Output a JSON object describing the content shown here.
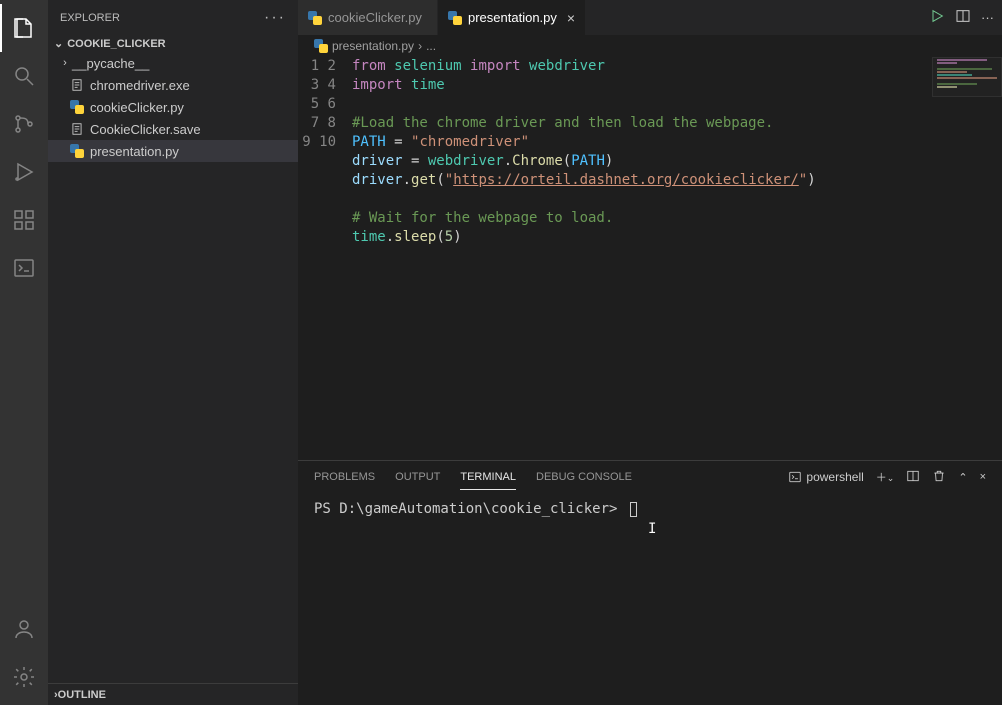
{
  "sidebar": {
    "title": "EXPLORER",
    "folder_name": "COOKIE_CLICKER",
    "items": [
      {
        "label": "__pycache__",
        "type": "folder"
      },
      {
        "label": "chromedriver.exe",
        "type": "file"
      },
      {
        "label": "cookieClicker.py",
        "type": "python"
      },
      {
        "label": "CookieClicker.save",
        "type": "file"
      },
      {
        "label": "presentation.py",
        "type": "python"
      }
    ],
    "outline_label": "OUTLINE"
  },
  "tabs": [
    {
      "label": "cookieClicker.py",
      "active": false
    },
    {
      "label": "presentation.py",
      "active": true
    }
  ],
  "breadcrumb": {
    "file": "presentation.py",
    "ellipsis": "..."
  },
  "code": {
    "line_numbers": [
      1,
      2,
      3,
      4,
      5,
      6,
      7,
      8,
      9,
      10
    ],
    "l1_from": "from",
    "l1_selenium": "selenium",
    "l1_import": "import",
    "l1_webdriver": "webdriver",
    "l2_import": "import",
    "l2_time": "time",
    "l4_comment": "#Load the chrome driver and then load the webpage.",
    "l5_path": "PATH",
    "l5_eq": " = ",
    "l5_str": "\"chromedriver\"",
    "l6_driver": "driver",
    "l6_eq": " = ",
    "l6_webdriver": "webdriver",
    "l6_dot": ".",
    "l6_chrome": "Chrome",
    "l6_lp": "(",
    "l6_path": "PATH",
    "l6_rp": ")",
    "l7_driver": "driver",
    "l7_dot": ".",
    "l7_get": "get",
    "l7_lp": "(",
    "l7_q1": "\"",
    "l7_url": "https://orteil.dashnet.org/cookieclicker/",
    "l7_q2": "\"",
    "l7_rp": ")",
    "l9_comment": "# Wait for the webpage to load.",
    "l10_time": "time",
    "l10_dot": ".",
    "l10_sleep": "sleep",
    "l10_lp": "(",
    "l10_num": "5",
    "l10_rp": ")"
  },
  "panel": {
    "tabs": [
      "PROBLEMS",
      "OUTPUT",
      "TERMINAL",
      "DEBUG CONSOLE"
    ],
    "active_tab": "TERMINAL",
    "shell_name": "powershell",
    "prompt": "PS D:\\gameAutomation\\cookie_clicker>"
  }
}
